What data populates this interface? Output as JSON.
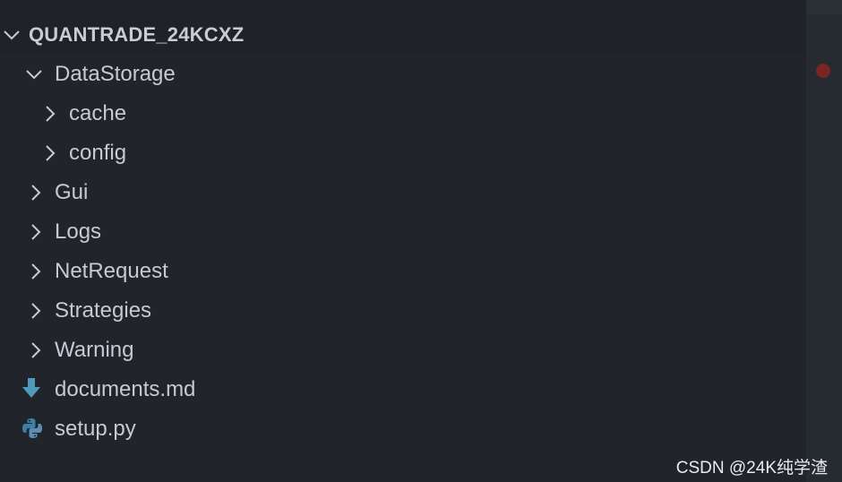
{
  "explorer": {
    "section_title": "QUANTRADE_24KCXZ",
    "items": [
      {
        "label": "DataStorage",
        "type": "folder",
        "expanded": true
      },
      {
        "label": "cache",
        "type": "folder",
        "expanded": false
      },
      {
        "label": "config",
        "type": "folder",
        "expanded": false
      },
      {
        "label": "Gui",
        "type": "folder",
        "expanded": false
      },
      {
        "label": "Logs",
        "type": "folder",
        "expanded": false
      },
      {
        "label": "NetRequest",
        "type": "folder",
        "expanded": false
      },
      {
        "label": "Strategies",
        "type": "folder",
        "expanded": false
      },
      {
        "label": "Warning",
        "type": "folder",
        "expanded": false
      },
      {
        "label": "documents.md",
        "type": "file",
        "icon": "markdown-download-icon"
      },
      {
        "label": "setup.py",
        "type": "file",
        "icon": "python-icon"
      }
    ]
  },
  "watermark": "CSDN @24K纯学渣",
  "colors": {
    "background": "#21252b",
    "text": "#c5cad3",
    "chevron": "#c5cad3",
    "markdown_icon": "#519aba",
    "python_icon": "#3d7fa8",
    "error_marker": "#7a2423"
  }
}
